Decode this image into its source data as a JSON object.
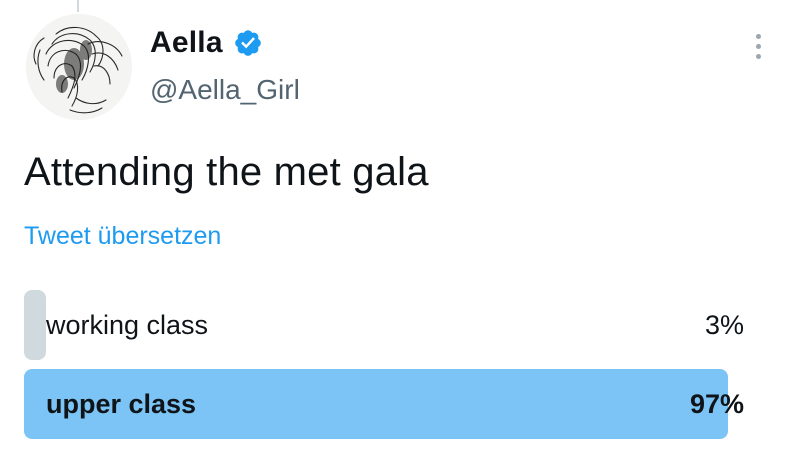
{
  "tweet": {
    "author": {
      "display_name": "Aella",
      "handle": "@Aella_Girl",
      "verified": true,
      "avatar_icon": "sketch-portrait-avatar"
    },
    "text": "Attending the met gala",
    "translate_label": "Tweet übersetzen",
    "more_icon": "more-vertical-icon"
  },
  "poll": {
    "options": [
      {
        "label": "working class",
        "percent_label": "3%",
        "percent": 3,
        "winner": false
      },
      {
        "label": "upper class",
        "percent_label": "97%",
        "percent": 97,
        "winner": true
      }
    ]
  },
  "colors": {
    "accent": "#1d9bf0",
    "poll_bar_default": "#cfd9de",
    "poll_bar_winner": "#7cc4f5",
    "secondary_text": "#536471"
  }
}
